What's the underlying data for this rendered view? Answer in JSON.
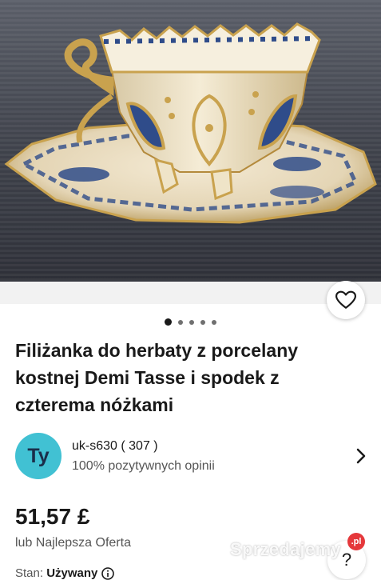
{
  "listing": {
    "title": "Filiżanka do herbaty z porcelany kostnej Demi Tasse i spodek z czterema nóżkami",
    "price": "51,57 £",
    "offer": "lub Najlepsza Oferta",
    "condition_label": "Stan:",
    "condition_value": "Używany"
  },
  "gallery": {
    "dot_count": 5,
    "active_index": 0
  },
  "seller": {
    "initials": "Ty",
    "name": "uk-s630 ( 307 )",
    "feedback": "100% pozytywnych opinii"
  },
  "watermark": {
    "text": "Sprzedajemy",
    "badge": ".pl"
  },
  "help": {
    "label": "?"
  },
  "colors": {
    "avatar": "#41c1d3",
    "avatar_text": "#1a2e4a",
    "text": "#191919",
    "secondary_text": "#555555",
    "background_band": "#f2f2f2"
  },
  "icons": {
    "favorite": "heart-icon",
    "seller_chevron": "chevron-right-icon",
    "condition_info": "info-icon",
    "help": "question-icon"
  }
}
